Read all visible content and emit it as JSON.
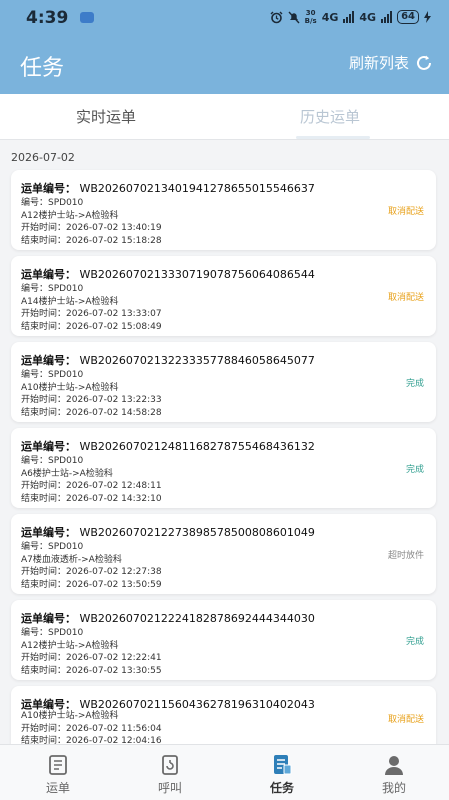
{
  "status_bar": {
    "time": "4:39",
    "speed_top": "30",
    "speed_bottom": "B/s",
    "net1": "4G",
    "net2": "4G",
    "battery": "64"
  },
  "header": {
    "title": "任务",
    "refresh_label": "刷新列表"
  },
  "tabs": [
    {
      "label": "实时运单"
    },
    {
      "label": "历史运单"
    }
  ],
  "date": "2026-07-02",
  "order_label": "运单编号：",
  "orders": [
    {
      "id": "WB2026070213401941278655015546637",
      "code": "编号：SPD010",
      "route": "A12楼护士站->A检验科",
      "start": "开始时间：2026-07-02 13:40:19",
      "end": "结束时间：2026-07-02 15:18:28",
      "status": "取消配送",
      "status_color": "#e8a21c"
    },
    {
      "id": "WB2026070213330719078756064086544",
      "code": "编号：SPD010",
      "route": "A14楼护士站->A检验科",
      "start": "开始时间：2026-07-02 13:33:07",
      "end": "结束时间：2026-07-02 15:08:49",
      "status": "取消配送",
      "status_color": "#e8a21c"
    },
    {
      "id": "WB2026070213223335778846058645077",
      "code": "编号：SPD010",
      "route": "A10楼护士站->A检验科",
      "start": "开始时间：2026-07-02 13:22:33",
      "end": "结束时间：2026-07-02 14:58:28",
      "status": "完成",
      "status_color": "#2f9e8f"
    },
    {
      "id": "WB2026070212481168278755468436132",
      "code": "编号：SPD010",
      "route": "A6楼护士站->A检验科",
      "start": "开始时间：2026-07-02 12:48:11",
      "end": "结束时间：2026-07-02 14:32:10",
      "status": "完成",
      "status_color": "#2f9e8f"
    },
    {
      "id": "WB2026070212273898578500808601049",
      "code": "编号：SPD010",
      "route": "A7楼血液透析->A检验科",
      "start": "开始时间：2026-07-02 12:27:38",
      "end": "结束时间：2026-07-02 13:50:59",
      "status": "超时放件",
      "status_color": "#8a8a8a"
    },
    {
      "id": "WB2026070212224182878692444344030",
      "code": "编号：SPD010",
      "route": "A12楼护士站->A检验科",
      "start": "开始时间：2026-07-02 12:22:41",
      "end": "结束时间：2026-07-02 13:30:55",
      "status": "完成",
      "status_color": "#2f9e8f"
    },
    {
      "id": "WB2026070211560436278196310402043",
      "code": "",
      "route": "A10楼护士站->A检验科",
      "start": "开始时间：2026-07-02 11:56:04",
      "end": "结束时间：2026-07-02 12:04:16",
      "status": "取消配送",
      "status_color": "#e8a21c"
    }
  ],
  "nav": [
    {
      "label": "运单",
      "icon": "waybill-icon"
    },
    {
      "label": "呼叫",
      "icon": "call-icon"
    },
    {
      "label": "任务",
      "icon": "task-icon",
      "active": true
    },
    {
      "label": "我的",
      "icon": "user-icon"
    }
  ]
}
